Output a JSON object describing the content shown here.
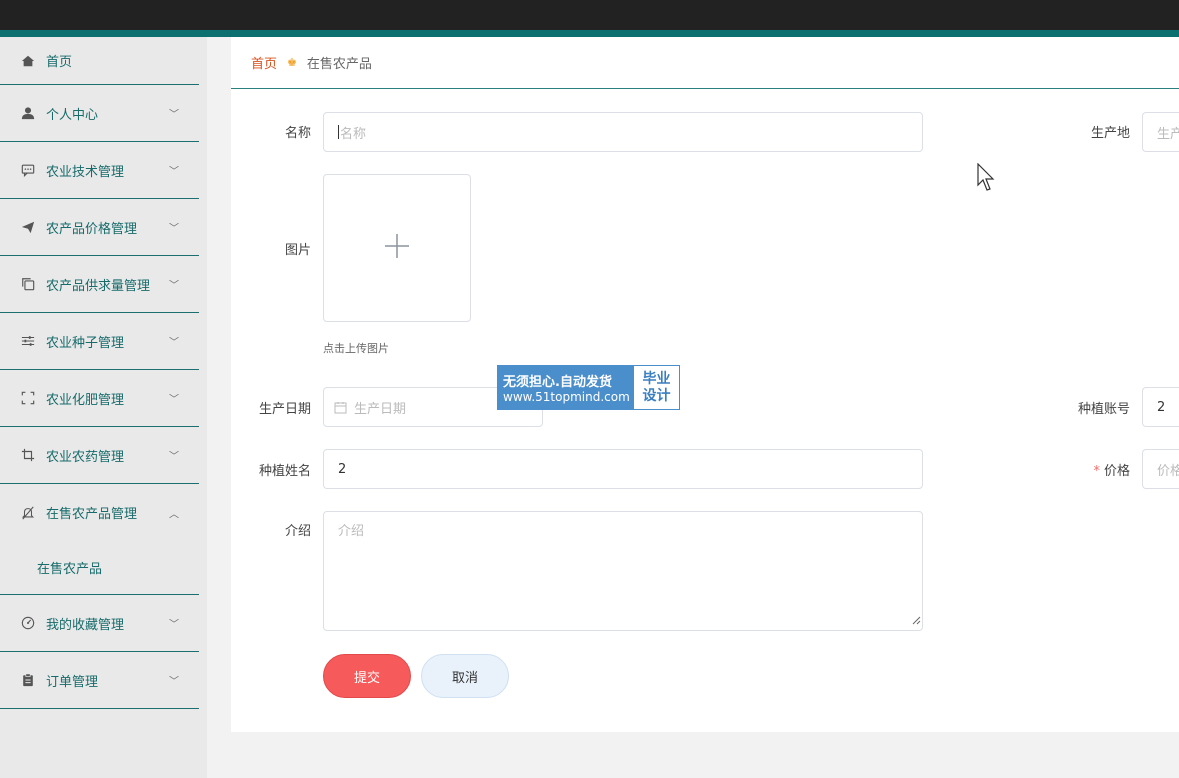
{
  "sidebar": {
    "items": [
      {
        "label": "首页",
        "icon": "home-icon",
        "has_chevron": false
      },
      {
        "label": "个人中心",
        "icon": "user-icon",
        "has_chevron": true
      },
      {
        "label": "农业技术管理",
        "icon": "chat-icon",
        "has_chevron": true
      },
      {
        "label": "农产品价格管理",
        "icon": "send-icon",
        "has_chevron": true
      },
      {
        "label": "农产品供求量管理",
        "icon": "copy-icon",
        "has_chevron": true
      },
      {
        "label": "农业种子管理",
        "icon": "sliders-icon",
        "has_chevron": true
      },
      {
        "label": "农业化肥管理",
        "icon": "frame-icon",
        "has_chevron": true
      },
      {
        "label": "农业农药管理",
        "icon": "crop-icon",
        "has_chevron": true
      },
      {
        "label": "在售农产品管理",
        "icon": "bell-off-icon",
        "has_chevron": true,
        "expanded": true
      },
      {
        "label": "我的收藏管理",
        "icon": "gauge-icon",
        "has_chevron": true
      },
      {
        "label": "订单管理",
        "icon": "clipboard-icon",
        "has_chevron": true
      }
    ],
    "submenu_label": "在售农产品"
  },
  "breadcrumb": {
    "home": "首页",
    "current": "在售农产品"
  },
  "form": {
    "name": {
      "label": "名称",
      "placeholder": "名称",
      "value": ""
    },
    "origin": {
      "label": "生产地",
      "placeholder": "生产地",
      "value": ""
    },
    "image": {
      "label": "图片",
      "tip": "点击上传图片"
    },
    "production_date": {
      "label": "生产日期",
      "placeholder": "生产日期",
      "value": ""
    },
    "planter_account": {
      "label": "种植账号",
      "value": "2"
    },
    "planter_name": {
      "label": "种植姓名",
      "value": "2"
    },
    "price": {
      "label": "价格",
      "placeholder": "价格",
      "required": true,
      "value": ""
    },
    "intro": {
      "label": "介绍",
      "placeholder": "介绍",
      "value": ""
    },
    "submit_label": "提交",
    "cancel_label": "取消"
  },
  "watermark": {
    "line1": "无须担心.自动发货",
    "line2": "www.51topmind.com",
    "right1": "毕业",
    "right2": "设计"
  },
  "colors": {
    "accent": "#0d6f6f",
    "sidebar_text": "#176b6b",
    "breadcrumb_home": "#d9531e",
    "submit": "#f65a5a",
    "cancel": "#e9f2fb"
  }
}
